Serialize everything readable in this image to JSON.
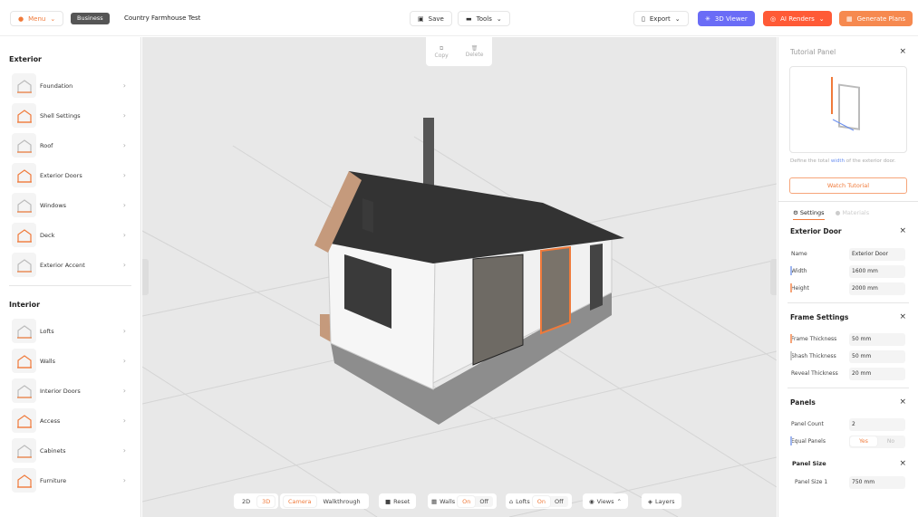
{
  "header": {
    "menu": "Menu",
    "badge": "Business",
    "project_title": "Country Farmhouse Test",
    "save": "Save",
    "tools": "Tools",
    "export": "Export",
    "viewer": "3D Viewer",
    "ai_renders": "AI Renders",
    "generate_plans": "Generate Plans"
  },
  "colors": {
    "accent": "#f07a3a",
    "viewer": "#6a6cf6",
    "ai": "#ff5a36",
    "plans": "#f6894f"
  },
  "sidebar": {
    "exterior_title": "Exterior",
    "exterior": [
      {
        "label": "Foundation"
      },
      {
        "label": "Shell Settings"
      },
      {
        "label": "Roof"
      },
      {
        "label": "Exterior Doors"
      },
      {
        "label": "Windows"
      },
      {
        "label": "Deck"
      },
      {
        "label": "Exterior Accent"
      }
    ],
    "interior_title": "Interior",
    "interior": [
      {
        "label": "Lofts"
      },
      {
        "label": "Walls"
      },
      {
        "label": "Interior Doors"
      },
      {
        "label": "Access"
      },
      {
        "label": "Cabinets"
      },
      {
        "label": "Furniture"
      }
    ]
  },
  "context": {
    "copy": "Copy",
    "delete": "Delete"
  },
  "tutorial": {
    "title": "Tutorial Panel",
    "caption_pre": "Define the total ",
    "caption_key": "width",
    "caption_post": " of the exterior door.",
    "button": "Watch Tutorial"
  },
  "tabs": {
    "settings": "Settings",
    "materials": "Materials"
  },
  "door": {
    "title": "Exterior Door",
    "fields": [
      {
        "k": "Name",
        "v": "Exterior Door"
      },
      {
        "k": "Width",
        "v": "1600 mm"
      },
      {
        "k": "Height",
        "v": "2000 mm"
      }
    ]
  },
  "frame": {
    "title": "Frame Settings",
    "fields": [
      {
        "k": "Frame Thickness",
        "v": "50 mm"
      },
      {
        "k": "Shash Thickness",
        "v": "50 mm"
      },
      {
        "k": "Reveal Thickness",
        "v": "20 mm"
      }
    ]
  },
  "panels": {
    "title": "Panels",
    "count_label": "Panel Count",
    "count": "2",
    "equal_label": "Equal Panels",
    "yes": "Yes",
    "no": "No",
    "size_title": "Panel Size",
    "size1_label": "Panel Size 1",
    "size1": "750 mm"
  },
  "bottom": {
    "d2": "2D",
    "d3": "3D",
    "camera": "Camera",
    "walkthrough": "Walkthrough",
    "reset": "Reset",
    "walls": "Walls",
    "lofts": "Lofts",
    "on": "On",
    "off": "Off",
    "views": "Views",
    "layers": "Layers"
  }
}
